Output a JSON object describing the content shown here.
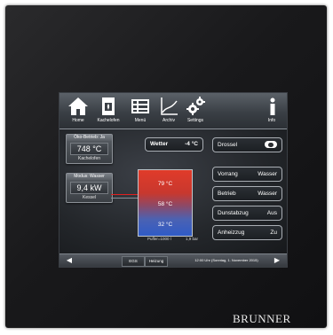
{
  "topbar": {
    "items": [
      {
        "label": "Home",
        "icon": "house-icon"
      },
      {
        "label": "Kachelofen",
        "icon": "stove-icon"
      },
      {
        "label": "Menü",
        "icon": "menu-list-icon"
      },
      {
        "label": "Archiv",
        "icon": "archive-chart-icon"
      },
      {
        "label": "Settings",
        "icon": "gears-icon"
      },
      {
        "label": "Info",
        "icon": "info-icon"
      }
    ]
  },
  "oven_box": {
    "title": "Öko-Betrieb: Ja",
    "value": "748 °C",
    "footer": "Kachelofen"
  },
  "kessel_box": {
    "title": "Modus: Wasser",
    "value": "9,4 kW",
    "footer": "Kessel"
  },
  "weather": {
    "label": "Wetter",
    "value": "-4 °C"
  },
  "drossel": {
    "label": "Drossel"
  },
  "buffer": {
    "top": "79 °C",
    "mid": "58 °C",
    "bottom": "32 °C",
    "volume": "Puffer=1000 l",
    "pressure": "1,9 bar"
  },
  "settings": [
    {
      "key": "Vorrang",
      "value": "Wasser"
    },
    {
      "key": "Betrieb",
      "value": "Wasser"
    },
    {
      "key": "Dunstabzug",
      "value": "Aus"
    },
    {
      "key": "Anheizzug",
      "value": "Zu"
    }
  ],
  "bottombar": {
    "left_arrow": "◀",
    "eg": "EGS",
    "heizung": "Heizung",
    "datetime": "12:00 Uhr (Sonntag, 1. November 2015)",
    "right_arrow": "▶"
  },
  "brand": "BRUNNER",
  "colors": {
    "hot": "#e03b2a",
    "cold": "#2f5bc7",
    "pipe_red": "#e02020"
  }
}
